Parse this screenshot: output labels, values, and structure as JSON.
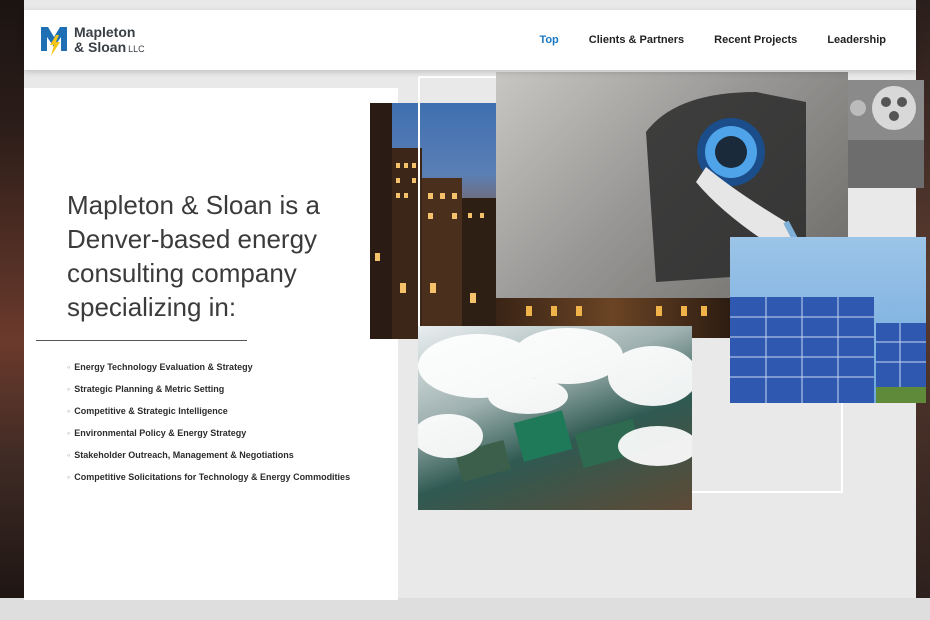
{
  "brand": {
    "line1": "Mapleton",
    "line2": "& Sloan",
    "suffix": "LLC",
    "logo_colors": {
      "m_blue": "#1f6fb5",
      "bolt_yellow": "#f5c518",
      "text": "#3a3f46"
    }
  },
  "nav": [
    {
      "label": "Top",
      "active": true
    },
    {
      "label": "Clients & Partners",
      "active": false
    },
    {
      "label": "Recent Projects",
      "active": false
    },
    {
      "label": "Leadership",
      "active": false
    }
  ],
  "hero": {
    "headline": "Mapleton & Sloan is a Denver-based energy consulting company specializing in:",
    "services": [
      "Energy Technology Evaluation & Strategy",
      "Strategic Planning & Metric Setting",
      "Competitive & Strategic Intelligence",
      "Environmental Policy & Energy Strategy",
      "Stakeholder Outreach, Management & Negotiations",
      "Competitive Solicitations for Technology & Energy Commodities"
    ]
  },
  "collage": {
    "images": [
      "city-skyline-dusk",
      "ev-charging-plug",
      "charging-connector-closeup",
      "aerial-clouds-wind-farm",
      "solar-panel-array"
    ]
  },
  "colors": {
    "accent": "#1d78c2",
    "text": "#3b3b3b",
    "header_bg": "#ffffff"
  }
}
